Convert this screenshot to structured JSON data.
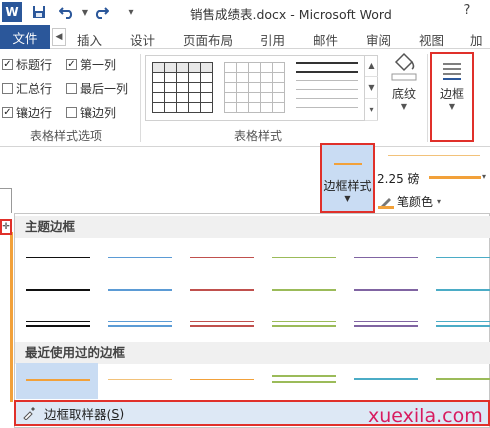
{
  "window": {
    "title": "销售成绩表.docx - Microsoft Word",
    "help": "?"
  },
  "qat": {
    "logo": "W",
    "save_icon": "floppy-disk-icon",
    "undo_icon": "undo-arrow-icon",
    "redo_icon": "redo-arrow-icon",
    "customize_icon": "customize-dropdown-icon"
  },
  "tabs": {
    "file": "文件",
    "items": [
      "插入",
      "设计",
      "页面布局",
      "引用",
      "邮件",
      "审阅",
      "视图",
      "加载"
    ]
  },
  "table_style_options": {
    "checks": [
      {
        "label": "标题行",
        "checked": true
      },
      {
        "label": "第一列",
        "checked": true
      },
      {
        "label": "汇总行",
        "checked": false
      },
      {
        "label": "最后一列",
        "checked": false
      },
      {
        "label": "镶边行",
        "checked": true
      },
      {
        "label": "镶边列",
        "checked": false
      }
    ],
    "group_label": "表格样式选项"
  },
  "table_styles": {
    "group_label": "表格样式"
  },
  "shading": {
    "label": "底纹"
  },
  "borders": {
    "label": "边框"
  },
  "border_styles": {
    "label": "边框样式",
    "line_weight": "2.25 磅",
    "pen_color": "笔颜色"
  },
  "menu": {
    "theme_header": "主题边框",
    "recent_header": "最近使用过的边框",
    "sampler_label": "边框取样器(",
    "sampler_key": "S",
    "sampler_close": ")"
  },
  "colors": {
    "word_blue": "#2b579a",
    "accent_orange": "#f2a13a",
    "highlight_red": "#e0302a",
    "selection_blue": "#c9dcf3"
  },
  "watermark": "xuexila.com"
}
